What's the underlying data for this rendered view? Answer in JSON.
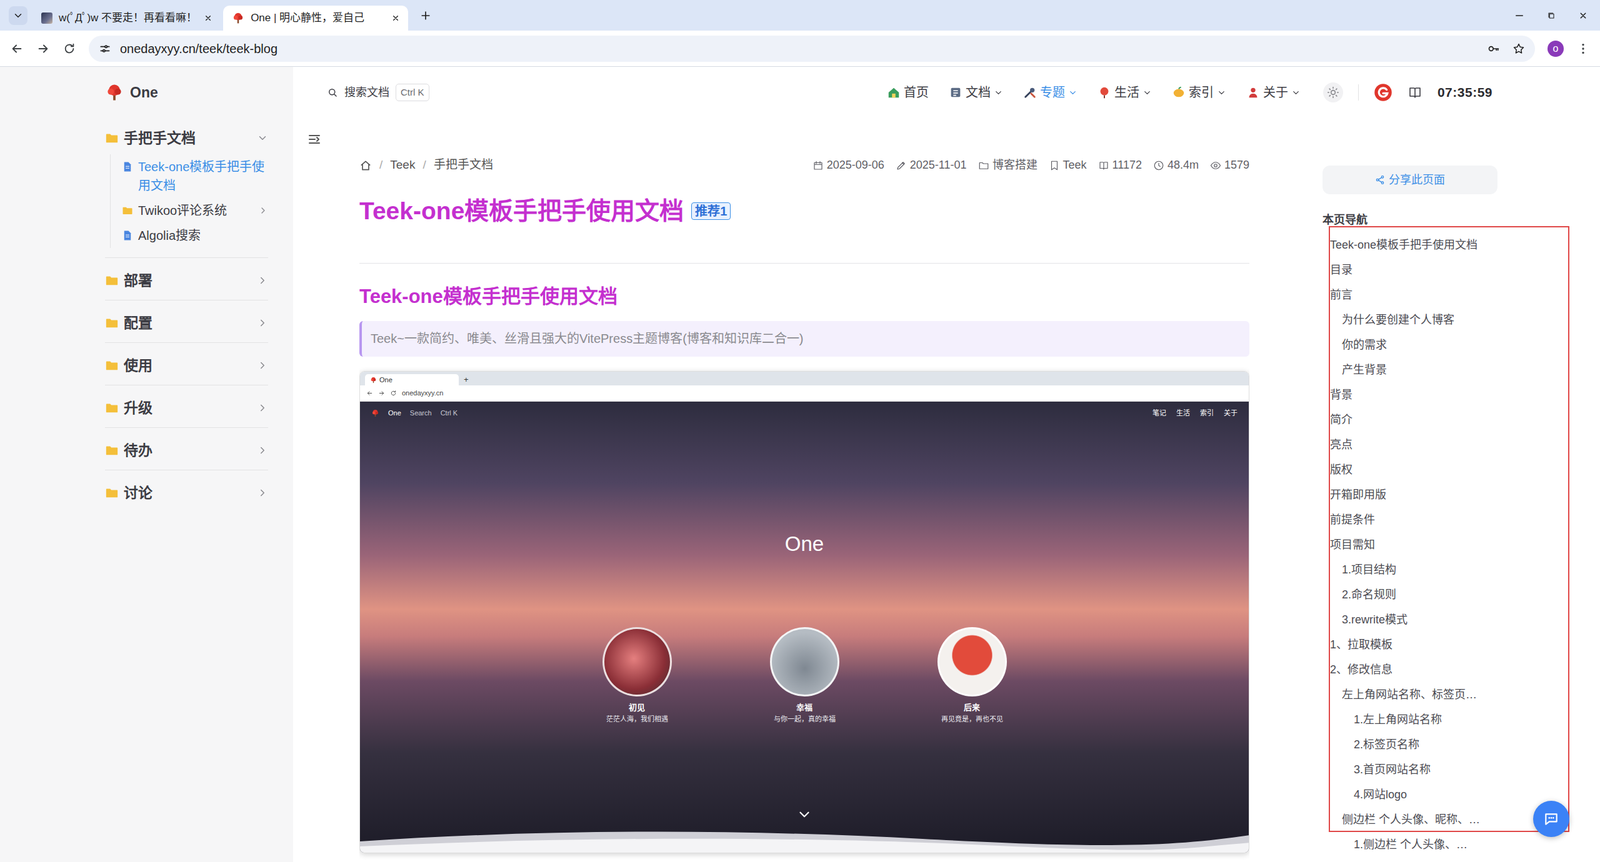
{
  "browser": {
    "tabs": [
      {
        "label": "w(ﾟДﾟ)w 不要走！再看看嘛！",
        "selected": false,
        "kind": "photo"
      },
      {
        "label": "One | 明心静性，爱自己",
        "selected": true,
        "kind": "logo"
      }
    ],
    "url": "onedayxyy.cn/teek/teek-blog",
    "profile": "o"
  },
  "site": {
    "logo": "One"
  },
  "sidebar": {
    "groups": [
      {
        "label": "手把手文档",
        "expanded": true,
        "children": [
          {
            "label": "Teek-one模板手把手使用文档",
            "kind": "doc",
            "selected": true
          },
          {
            "label": "Twikoo评论系统",
            "kind": "folder",
            "selected": false
          },
          {
            "label": "Algolia搜索",
            "kind": "doc",
            "selected": false
          }
        ]
      },
      {
        "label": "部署",
        "expanded": false,
        "children": []
      },
      {
        "label": "配置",
        "expanded": false,
        "children": []
      },
      {
        "label": "使用",
        "expanded": false,
        "children": []
      },
      {
        "label": "升级",
        "expanded": false,
        "children": []
      },
      {
        "label": "待办",
        "expanded": false,
        "children": []
      },
      {
        "label": "讨论",
        "expanded": false,
        "children": []
      }
    ]
  },
  "header": {
    "search": {
      "label": "搜索文档",
      "shortcut": "Ctrl K"
    },
    "nav": [
      {
        "label": "首页",
        "dropdown": false,
        "selected": false
      },
      {
        "label": "文档",
        "dropdown": true,
        "selected": false
      },
      {
        "label": "专题",
        "dropdown": true,
        "selected": true
      },
      {
        "label": "生活",
        "dropdown": true,
        "selected": false
      },
      {
        "label": "索引",
        "dropdown": true,
        "selected": false
      },
      {
        "label": "关于",
        "dropdown": true,
        "selected": false
      }
    ],
    "time": "07:35:59"
  },
  "breadcrumb": {
    "separator": "/",
    "items": [
      "Teek",
      "手把手文档"
    ]
  },
  "meta": [
    {
      "kind": "created",
      "text": "2025-09-06"
    },
    {
      "kind": "updated",
      "text": "2025-11-01"
    },
    {
      "kind": "category",
      "text": "博客搭建"
    },
    {
      "kind": "tag",
      "text": "Teek"
    },
    {
      "kind": "words",
      "text": "11172"
    },
    {
      "kind": "reading",
      "text": "48.4m"
    },
    {
      "kind": "views",
      "text": "1579"
    }
  ],
  "article": {
    "title": "Teek-one模板手把手使用文档",
    "badge": "推荐1",
    "heading": "Teek-one模板手把手使用文档",
    "quote": "Teek~一款简约、唯美、丝滑且强大的VitePress主题博客(博客和知识库二合一)",
    "preview": {
      "tab": "One",
      "new_tab": "+",
      "url": "onedayxyy.cn",
      "logo": "One",
      "search": "Search",
      "shortcut": "Ctrl K",
      "nav": [
        "笔记",
        "生活",
        "索引",
        "关于"
      ],
      "hero_title": "One",
      "cards": [
        {
          "title": "初见",
          "caption": "茫茫人海，我们相遇"
        },
        {
          "title": "幸福",
          "caption": "与你一起，真的幸福"
        },
        {
          "title": "后来",
          "caption": "再见竟是，再也不见"
        }
      ]
    }
  },
  "aside": {
    "share": "分享此页面",
    "toc_title": "本页导航",
    "toc": [
      {
        "label": "Teek-one模板手把手使用文档",
        "depth": 1,
        "boxed": true
      },
      {
        "label": "目录",
        "depth": 1,
        "boxed": true
      },
      {
        "label": "前言",
        "depth": 1,
        "boxed": true
      },
      {
        "label": "为什么要创建个人博客",
        "depth": 2,
        "boxed": true
      },
      {
        "label": "你的需求",
        "depth": 2,
        "boxed": true
      },
      {
        "label": "产生背景",
        "depth": 2,
        "boxed": true
      },
      {
        "label": "背景",
        "depth": 1,
        "boxed": true
      },
      {
        "label": "简介",
        "depth": 1,
        "boxed": true
      },
      {
        "label": "亮点",
        "depth": 1,
        "boxed": true
      },
      {
        "label": "版权",
        "depth": 1,
        "boxed": true
      },
      {
        "label": "开箱即用版",
        "depth": 1,
        "boxed": true
      },
      {
        "label": "前提条件",
        "depth": 1,
        "boxed": true
      },
      {
        "label": "项目需知",
        "depth": 1,
        "boxed": true
      },
      {
        "label": "1.项目结构",
        "depth": 2,
        "boxed": true
      },
      {
        "label": "2.命名规则",
        "depth": 2,
        "boxed": true
      },
      {
        "label": "3.rewrite模式",
        "depth": 2,
        "boxed": true
      },
      {
        "label": "1、拉取模板",
        "depth": 1,
        "boxed": true
      },
      {
        "label": "2、修改信息",
        "depth": 1,
        "boxed": true
      },
      {
        "label": "左上角网站名称、标签页…",
        "depth": 2,
        "boxed": true
      },
      {
        "label": "1.左上角网站名称",
        "depth": 3,
        "boxed": true
      },
      {
        "label": "2.标签页名称",
        "depth": 3,
        "boxed": true
      },
      {
        "label": "3.首页网站名称",
        "depth": 3,
        "boxed": true
      },
      {
        "label": "4.网站logo",
        "depth": 3,
        "boxed": true
      },
      {
        "label": "侧边栏 个人头像、昵称、…",
        "depth": 2,
        "boxed": true
      },
      {
        "label": "1.侧边栏 个人头像、…",
        "depth": 3,
        "boxed": false
      }
    ]
  }
}
